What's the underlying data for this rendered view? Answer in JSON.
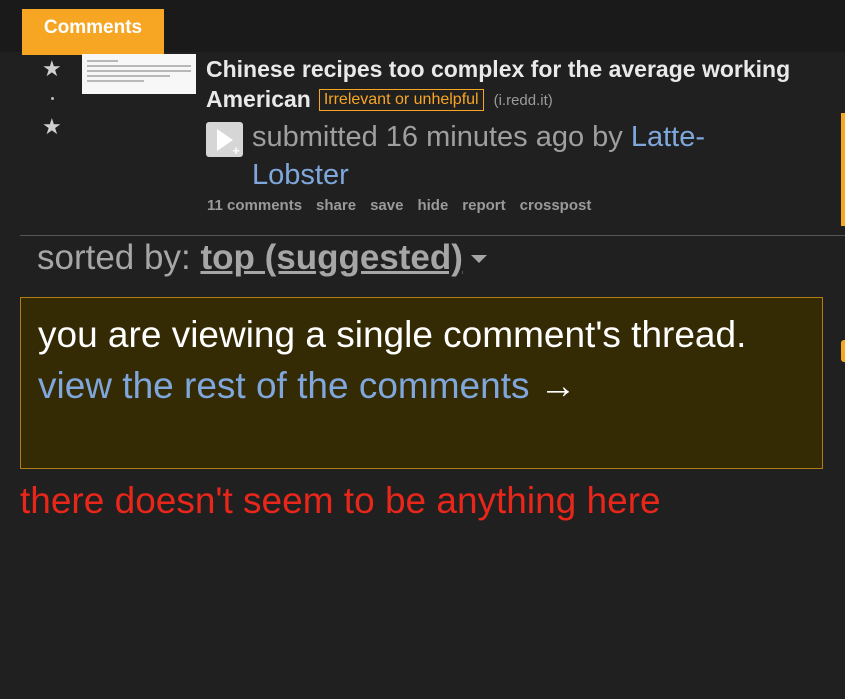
{
  "header": {
    "tab_label": "Comments"
  },
  "post": {
    "title": "Chinese recipes too complex for the average working American",
    "flair": "Irrelevant or unhelpful",
    "domain": "(i.redd.it)",
    "tagline_prefix": "submitted 16 minutes ago by",
    "author": "Latte-Lobster",
    "buttons": [
      "11 comments",
      "share",
      "save",
      "hide",
      "report",
      "crosspost"
    ]
  },
  "sort": {
    "label": "sorted by:",
    "value": "top (suggested)"
  },
  "notice": {
    "message": "you are viewing a single comment's thread.",
    "link": "view the rest of the comments",
    "arrow": "→"
  },
  "empty_message": "there doesn't seem to be anything here",
  "colors": {
    "accent": "#f6a623",
    "link": "#7fa7dc",
    "error": "#e8261a",
    "notice_bg": "#342b05"
  }
}
